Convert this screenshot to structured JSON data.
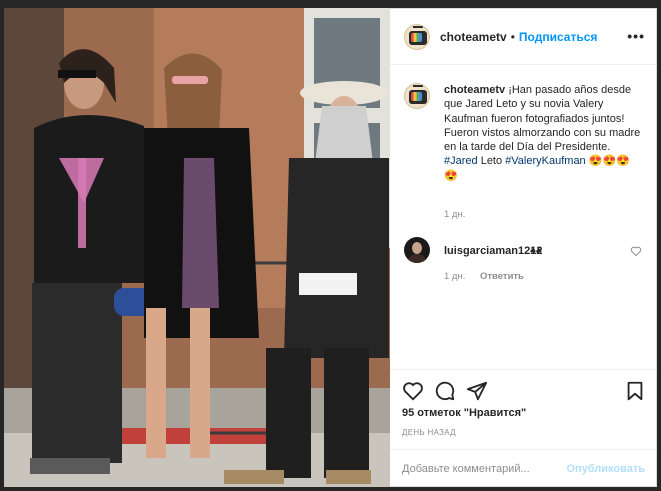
{
  "header": {
    "username": "choteametv",
    "separator": "•",
    "follow_label": "Подписаться",
    "more_icon": "more-icon",
    "more_label": "•••"
  },
  "caption": {
    "username": "choteametv",
    "text": "¡Han pasado años desde que Jared Leto y su novia Valery Kaufman fueron fotografiados juntos! Fueron vistos almorzando con su madre en la tarde del Día del Presidente.",
    "hashtag1": "#Jared",
    "word": " Leto ",
    "hashtag2": "#ValeryKaufman",
    "emoji_line1": " 😍😍😍",
    "emoji_line2": "😍",
    "time": "1 дн."
  },
  "comment": {
    "username": "luisgarciaman1212",
    "text": "♠♠",
    "time": "1 дн.",
    "reply_label": "Ответить"
  },
  "actions": {
    "likes": "95 отметок \"Нравится\"",
    "date": "ДЕНЬ НАЗАД"
  },
  "add_comment": {
    "placeholder": "Добавьте комментарий...",
    "publish_label": "Опубликовать"
  },
  "colors": {
    "accent": "#0095f6",
    "hashtag": "#00376b",
    "muted": "#8e8e8e"
  }
}
